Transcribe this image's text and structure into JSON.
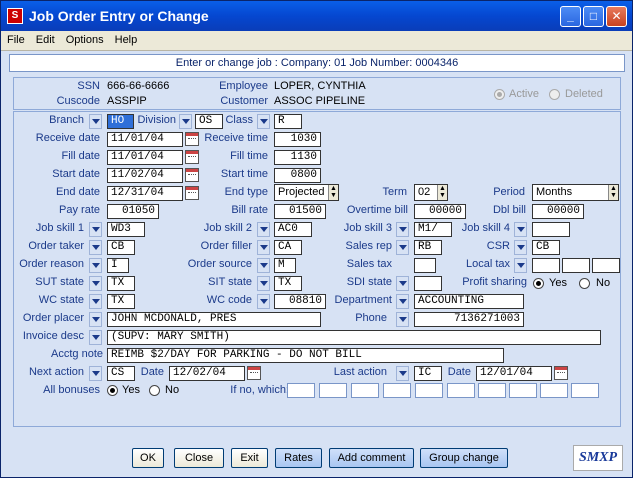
{
  "window": {
    "title": "Job Order Entry or Change",
    "app_icon_letter": "S",
    "minimize": "_",
    "maximize": "□",
    "close": "✕"
  },
  "menu": [
    "File",
    "Edit",
    "Options",
    "Help"
  ],
  "info_bar": "Enter or change job :  Company:  01   Job Number:  0004346",
  "header": {
    "ssn_label": "SSN",
    "ssn": "666-66-6666",
    "employee_label": "Employee",
    "employee": "LOPER, CYNTHIA",
    "cuscode_label": "Cuscode",
    "cuscode": "ASSPIP",
    "customer_label": "Customer",
    "customer": "ASSOC PIPELINE",
    "active_label": "Active",
    "deleted_label": "Deleted"
  },
  "form": {
    "branch_label": "Branch",
    "branch": "HO",
    "division_label": "Division",
    "division": "OS",
    "class_label": "Class",
    "class": "R",
    "receive_date_label": "Receive date",
    "receive_date": "11/01/04",
    "receive_time_label": "Receive time",
    "receive_time": "1030",
    "fill_date_label": "Fill date",
    "fill_date": "11/01/04",
    "fill_time_label": "Fill time",
    "fill_time": "1130",
    "start_date_label": "Start date",
    "start_date": "11/02/04",
    "start_time_label": "Start time",
    "start_time": "0800",
    "end_date_label": "End date",
    "end_date": "12/31/04",
    "end_type_label": "End type",
    "end_type": "Projected",
    "term_label": "Term",
    "term": "02",
    "period_label": "Period",
    "period": "Months",
    "pay_rate_label": "Pay rate",
    "pay_rate": "01050",
    "bill_rate_label": "Bill rate",
    "bill_rate": "01500",
    "overtime_bill_label": "Overtime bill",
    "overtime_bill": "00000",
    "dbl_bill_label": "Dbl bill",
    "dbl_bill": "00000",
    "job_skill1_label": "Job skill 1",
    "job_skill1": "WD3",
    "job_skill2_label": "Job skill 2",
    "job_skill2": "AC0",
    "job_skill3_label": "Job skill 3",
    "job_skill3": "M1/",
    "job_skill4_label": "Job skill 4",
    "job_skill4": "",
    "order_taker_label": "Order taker",
    "order_taker": "CB",
    "order_filler_label": "Order filler",
    "order_filler": "CA",
    "sales_rep_label": "Sales rep",
    "sales_rep": "RB",
    "csr_label": "CSR",
    "csr": "CB",
    "order_reason_label": "Order reason",
    "order_reason": "I",
    "order_source_label": "Order source",
    "order_source": "M",
    "sales_tax_label": "Sales tax",
    "sales_tax": "",
    "local_tax_label": "Local tax",
    "sut_state_label": "SUT state",
    "sut_state": "TX",
    "sit_state_label": "SIT state",
    "sit_state": "TX",
    "sdi_state_label": "SDI state",
    "sdi_state": "",
    "profit_sharing_label": "Profit sharing",
    "yes": "Yes",
    "no": "No",
    "wc_state_label": "WC state",
    "wc_state": "TX",
    "wc_code_label": "WC code",
    "wc_code": "08810",
    "department_label": "Department",
    "department": "ACCOUNTING",
    "order_placer_label": "Order placer",
    "order_placer": "JOHN MCDONALD, PRES",
    "phone_label": "Phone",
    "phone": "7136271003",
    "invoice_desc_label": "Invoice desc",
    "invoice_desc": "(SUPV: MARY SMITH)",
    "acctg_note_label": "Acctg note",
    "acctg_note": "REIMB $2/DAY FOR PARKING - DO NOT BILL",
    "next_action_label": "Next action",
    "next_action": "CS",
    "next_date_label": "Date",
    "next_date": "12/02/04",
    "last_action_label": "Last action",
    "last_action": "IC",
    "last_date_label": "Date",
    "last_date": "12/01/04",
    "all_bonuses_label": "All bonuses",
    "if_no_label": "If no, which:"
  },
  "buttons": {
    "ok": "OK",
    "close": "Close",
    "exit": "Exit",
    "rates": "Rates",
    "add_comment": "Add comment",
    "group_change": "Group change"
  },
  "logo": {
    "text": "SMXP"
  }
}
